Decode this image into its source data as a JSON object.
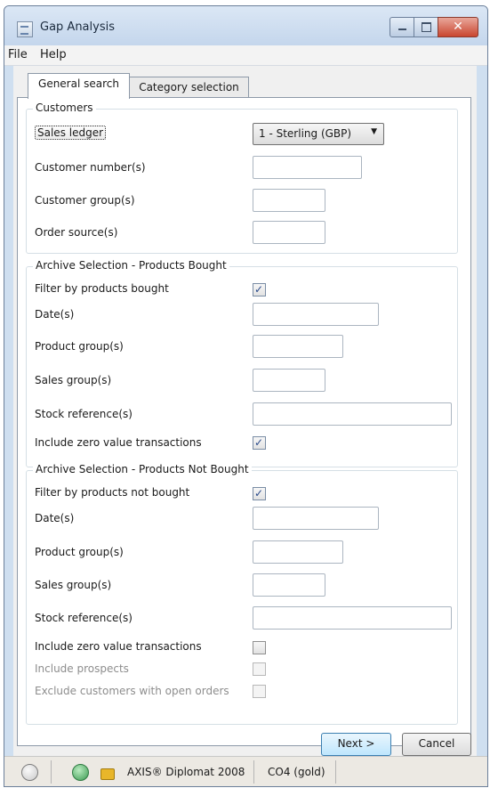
{
  "window": {
    "title": "Gap Analysis"
  },
  "menu": {
    "items": [
      "File",
      "Help"
    ]
  },
  "tabs": [
    "General search",
    "Category selection"
  ],
  "customers": {
    "title": "Customers",
    "sales_ledger_label": "Sales ledger",
    "sales_ledger_value": "1 - Sterling (GBP)",
    "customer_numbers_label": "Customer number(s)",
    "customer_groups_label": "Customer group(s)",
    "order_source_label": "Order source(s)"
  },
  "bought": {
    "title": "Archive Selection - Products Bought",
    "filter_label": "Filter by products bought",
    "filter_checked": true,
    "dates_label": "Date(s)",
    "product_groups_label": "Product group(s)",
    "sales_groups_label": "Sales group(s)",
    "stock_refs_label": "Stock reference(s)",
    "zero_value_label": "Include zero value transactions",
    "zero_value_checked": true
  },
  "not_bought": {
    "title": "Archive Selection - Products Not Bought",
    "filter_label": "Filter by products not bought",
    "filter_checked": true,
    "dates_label": "Date(s)",
    "product_groups_label": "Product group(s)",
    "sales_groups_label": "Sales group(s)",
    "stock_refs_label": "Stock reference(s)",
    "zero_value_label": "Include zero value transactions",
    "zero_value_checked": false,
    "prospects_label": "Include prospects",
    "prospects_checked": false,
    "exclude_open_orders_label": "Exclude customers with open orders",
    "exclude_open_orders_checked": false
  },
  "buttons": {
    "next": "Next >",
    "cancel": "Cancel"
  },
  "status": {
    "product": "AXIS® Diplomat 2008",
    "company": "CO4 (gold)"
  },
  "icons": [
    "app-icon",
    "minimize-icon",
    "maximize-icon",
    "close-icon",
    "help-icon",
    "globe-icon",
    "lock-icon"
  ]
}
